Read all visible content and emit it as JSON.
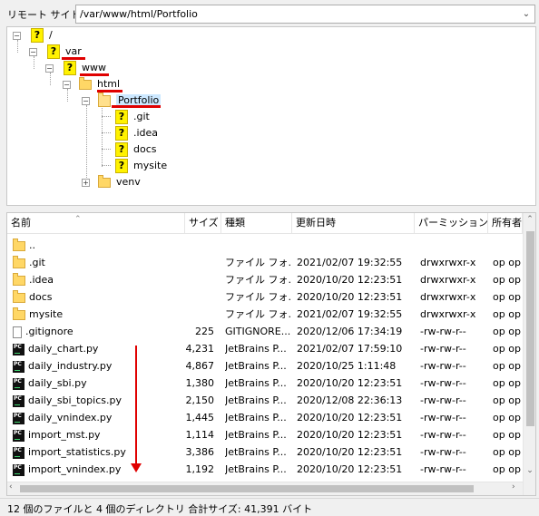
{
  "path_bar": {
    "label": "リモート サイト:",
    "value": "/var/www/html/Portfolio"
  },
  "tree": [
    {
      "label": "/",
      "icon": "question-folder-icon"
    },
    {
      "label": "var",
      "icon": "question-folder-icon"
    },
    {
      "label": "www",
      "icon": "question-folder-icon"
    },
    {
      "label": "html",
      "icon": "folder-icon"
    },
    {
      "label": "Portfolio",
      "icon": "folder-icon",
      "selected": true
    },
    {
      "label": ".git",
      "icon": "question-folder-icon"
    },
    {
      "label": ".idea",
      "icon": "question-folder-icon"
    },
    {
      "label": "docs",
      "icon": "question-folder-icon"
    },
    {
      "label": "mysite",
      "icon": "question-folder-icon"
    },
    {
      "label": "venv",
      "icon": "folder-icon"
    }
  ],
  "columns": {
    "name": "名前",
    "size": "サイズ",
    "type": "種類",
    "date": "更新日時",
    "perm": "パーミッション",
    "owner": "所有者"
  },
  "files": [
    {
      "icon": "folder-icon",
      "name": "..",
      "size": "",
      "type": "",
      "date": "",
      "perm": "",
      "owner": ""
    },
    {
      "icon": "folder-icon",
      "name": ".git",
      "size": "",
      "type": "ファイル フォ...",
      "date": "2021/02/07 19:32:55",
      "perm": "drwxrwxr-x",
      "owner": "op op"
    },
    {
      "icon": "folder-icon",
      "name": ".idea",
      "size": "",
      "type": "ファイル フォ...",
      "date": "2020/10/20 12:23:51",
      "perm": "drwxrwxr-x",
      "owner": "op op"
    },
    {
      "icon": "folder-icon",
      "name": "docs",
      "size": "",
      "type": "ファイル フォ...",
      "date": "2020/10/20 12:23:51",
      "perm": "drwxrwxr-x",
      "owner": "op op"
    },
    {
      "icon": "folder-icon",
      "name": "mysite",
      "size": "",
      "type": "ファイル フォ...",
      "date": "2021/02/07 19:32:55",
      "perm": "drwxrwxr-x",
      "owner": "op op"
    },
    {
      "icon": "file-icon",
      "name": ".gitignore",
      "size": "225",
      "type": "GITIGNORE...",
      "date": "2020/12/06 17:34:19",
      "perm": "-rw-rw-r--",
      "owner": "op op"
    },
    {
      "icon": "pycharm-icon",
      "name": "daily_chart.py",
      "size": "4,231",
      "type": "JetBrains P...",
      "date": "2021/02/07 17:59:10",
      "perm": "-rw-rw-r--",
      "owner": "op op"
    },
    {
      "icon": "pycharm-icon",
      "name": "daily_industry.py",
      "size": "4,867",
      "type": "JetBrains P...",
      "date": "2020/10/25 1:11:48",
      "perm": "-rw-rw-r--",
      "owner": "op op"
    },
    {
      "icon": "pycharm-icon",
      "name": "daily_sbi.py",
      "size": "1,380",
      "type": "JetBrains P...",
      "date": "2020/10/20 12:23:51",
      "perm": "-rw-rw-r--",
      "owner": "op op"
    },
    {
      "icon": "pycharm-icon",
      "name": "daily_sbi_topics.py",
      "size": "2,150",
      "type": "JetBrains P...",
      "date": "2020/12/08 22:36:13",
      "perm": "-rw-rw-r--",
      "owner": "op op"
    },
    {
      "icon": "pycharm-icon",
      "name": "daily_vnindex.py",
      "size": "1,445",
      "type": "JetBrains P...",
      "date": "2020/10/20 12:23:51",
      "perm": "-rw-rw-r--",
      "owner": "op op"
    },
    {
      "icon": "pycharm-icon",
      "name": "import_mst.py",
      "size": "1,114",
      "type": "JetBrains P...",
      "date": "2020/10/20 12:23:51",
      "perm": "-rw-rw-r--",
      "owner": "op op"
    },
    {
      "icon": "pycharm-icon",
      "name": "import_statistics.py",
      "size": "3,386",
      "type": "JetBrains P...",
      "date": "2020/10/20 12:23:51",
      "perm": "-rw-rw-r--",
      "owner": "op op"
    },
    {
      "icon": "pycharm-icon",
      "name": "import_vnindex.py",
      "size": "1,192",
      "type": "JetBrains P...",
      "date": "2020/10/20 12:23:51",
      "perm": "-rw-rw-r--",
      "owner": "op op"
    }
  ],
  "status": "12 個のファイルと 4 個のディレクトリ 合計サイズ: 41,391 バイト",
  "annotation_color": "#e00000"
}
